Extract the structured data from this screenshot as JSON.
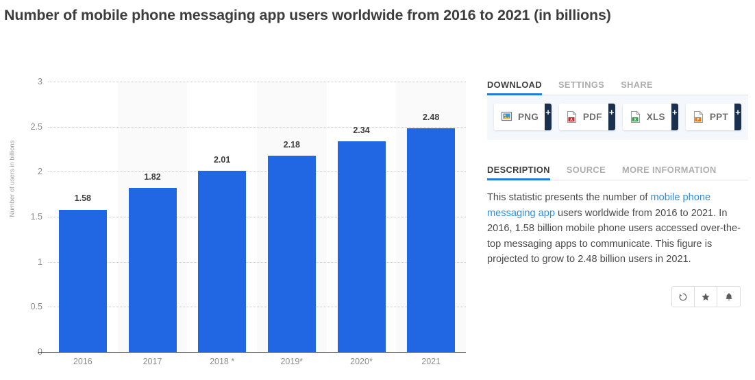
{
  "title": "Number of mobile phone messaging app users worldwide from 2016 to 2021 (in billions)",
  "chart_data": {
    "type": "bar",
    "title": "Number of mobile phone messaging app users worldwide from 2016 to 2021 (in billions)",
    "categories": [
      "2016",
      "2017",
      "2018 *",
      "2019*",
      "2020*",
      "2021"
    ],
    "values": [
      1.58,
      1.82,
      2.01,
      2.18,
      2.34,
      2.48
    ],
    "data_labels": [
      "1.58",
      "1.82",
      "2.01",
      "2.18",
      "2.34",
      "2.48"
    ],
    "xlabel": "",
    "ylabel": "Number of users in billions",
    "ylim": [
      0,
      3
    ],
    "yticks": [
      0,
      0.5,
      1,
      1.5,
      2,
      2.5,
      3
    ],
    "ytick_labels": [
      "0",
      "0.5",
      "1",
      "1.5",
      "2",
      "2.5",
      "3"
    ],
    "grid": true,
    "legend": false,
    "bar_color": "#2167e3",
    "band_color": "#fafafa"
  },
  "panel": {
    "export_tabs": [
      {
        "label": "DOWNLOAD",
        "active": true
      },
      {
        "label": "SETTINGS",
        "active": false
      },
      {
        "label": "SHARE",
        "active": false
      }
    ],
    "download_buttons": [
      {
        "label": "PNG",
        "icon": "png-file-icon",
        "plus": "+",
        "accent": "#3d8fd6"
      },
      {
        "label": "PDF",
        "icon": "pdf-file-icon",
        "plus": "+",
        "accent": "#d32222"
      },
      {
        "label": "XLS",
        "icon": "xls-file-icon",
        "plus": "+",
        "accent": "#31a24c"
      },
      {
        "label": "PPT",
        "icon": "ppt-file-icon",
        "plus": "+",
        "accent": "#e8710a"
      }
    ],
    "info_tabs": [
      {
        "label": "DESCRIPTION",
        "active": true
      },
      {
        "label": "SOURCE",
        "active": false
      },
      {
        "label": "MORE INFORMATION",
        "active": false
      }
    ],
    "description": {
      "part1": "This statistic presents the number of ",
      "link": "mobile phone messaging app",
      "part2": " users worldwide from 2016 to 2021. In 2016, 1.58 billion mobile phone users accessed over-the-top messaging apps to communicate. This figure is projected to grow to 2.48 billion users in 2021."
    },
    "actions": [
      {
        "name": "history-icon",
        "glyph": "↺"
      },
      {
        "name": "star-icon",
        "glyph": "★"
      },
      {
        "name": "bell-icon",
        "glyph": "🔔"
      }
    ]
  },
  "colors": {
    "accent_blue": "#1e7bdd",
    "bar_blue": "#2167e3",
    "link_blue": "#2f8de0",
    "navy": "#19304f",
    "panel_bg": "#f4f7fb"
  }
}
